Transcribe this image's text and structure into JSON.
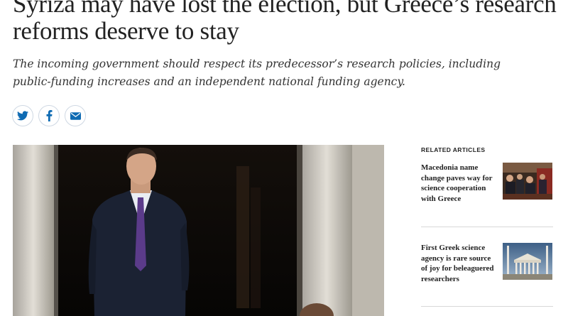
{
  "article": {
    "headline": "Syriza may have lost the election, but Greece’s research reforms deserve to stay",
    "standfirst": "The incoming government should respect its predecessor’s research policies, including public-funding increases and an independent national funding agency."
  },
  "share": {
    "icons": [
      "twitter-icon",
      "facebook-icon",
      "email-icon"
    ],
    "brand_color": "#0f6bb3"
  },
  "related": {
    "heading": "RELATED ARTICLES",
    "items": [
      {
        "title": "Macedonia name change paves way for science cooperation with Greece"
      },
      {
        "title": "First Greek science agency is rare source of joy for beleaguered researchers"
      }
    ]
  }
}
